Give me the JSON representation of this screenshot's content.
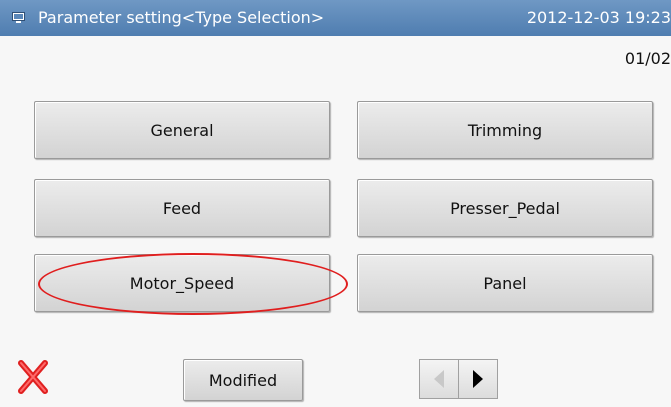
{
  "header": {
    "title": "Parameter setting<Type Selection>",
    "datetime": "2012-12-03  19:23"
  },
  "page_indicator": "01/02",
  "type_buttons": [
    {
      "label": "General"
    },
    {
      "label": "Trimming"
    },
    {
      "label": "Feed"
    },
    {
      "label": "Presser_Pedal"
    },
    {
      "label": "Motor_Speed"
    },
    {
      "label": "Panel"
    }
  ],
  "footer": {
    "close_icon": "red-x-icon",
    "modified_label": "Modified",
    "prev_icon": "triangle-left-icon",
    "next_icon": "triangle-right-icon"
  },
  "colors": {
    "titlebar": "#5a87b9",
    "highlight": "#e01e1e",
    "close": "#e02020"
  }
}
